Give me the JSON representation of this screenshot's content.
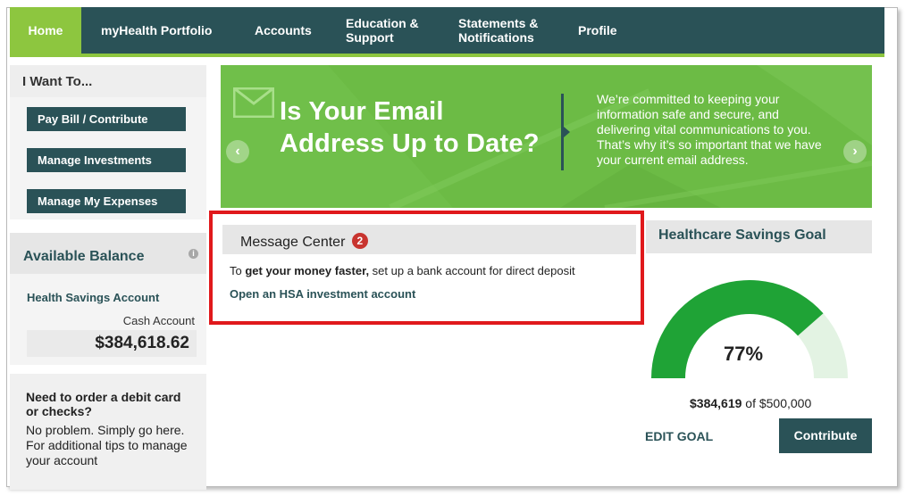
{
  "nav": {
    "home": "Home",
    "portfolio": "myHealth Portfolio",
    "accounts": "Accounts",
    "education_1": "Education &",
    "education_2": "Support",
    "statements_1": "Statements &",
    "statements_2": "Notifications",
    "profile": "Profile"
  },
  "iwant": {
    "title": "I Want To...",
    "buttons": [
      "Pay Bill / Contribute",
      "Manage Investments",
      "Manage My Expenses"
    ]
  },
  "balance": {
    "title": "Available Balance",
    "info": "i",
    "account_name": "Health Savings Account",
    "cash_label": "Cash Account",
    "cash_amount": "$384,618.62"
  },
  "promo": {
    "title": "Need to order a debit card or checks?",
    "text_1": "No problem. Simply go here.",
    "text_2": "For additional tips to manage your account"
  },
  "banner": {
    "head_1": "Is Your Email",
    "head_2": "Address Up to Date?",
    "text": "We’re committed to keeping your information safe and secure, and delivering vital communications to you. That’s why it’s so important that we have your current email address.",
    "prev": "‹",
    "next": "›"
  },
  "message_center": {
    "title": "Message Center",
    "badge": "2",
    "line_prefix": "To ",
    "line_bold": "get your money faster,",
    "line_suffix": " set up a bank account for direct deposit",
    "link": "Open an HSA investment account"
  },
  "goal": {
    "title": "Healthcare Savings Goal",
    "percent_label": "77%",
    "progress": 0.77,
    "saved": "$384,619",
    "of_text": " of $500,000",
    "edit": "EDIT GOAL",
    "contribute": "Contribute",
    "colors": {
      "filled": "#1fa336",
      "empty": "#e3f3e3"
    }
  }
}
